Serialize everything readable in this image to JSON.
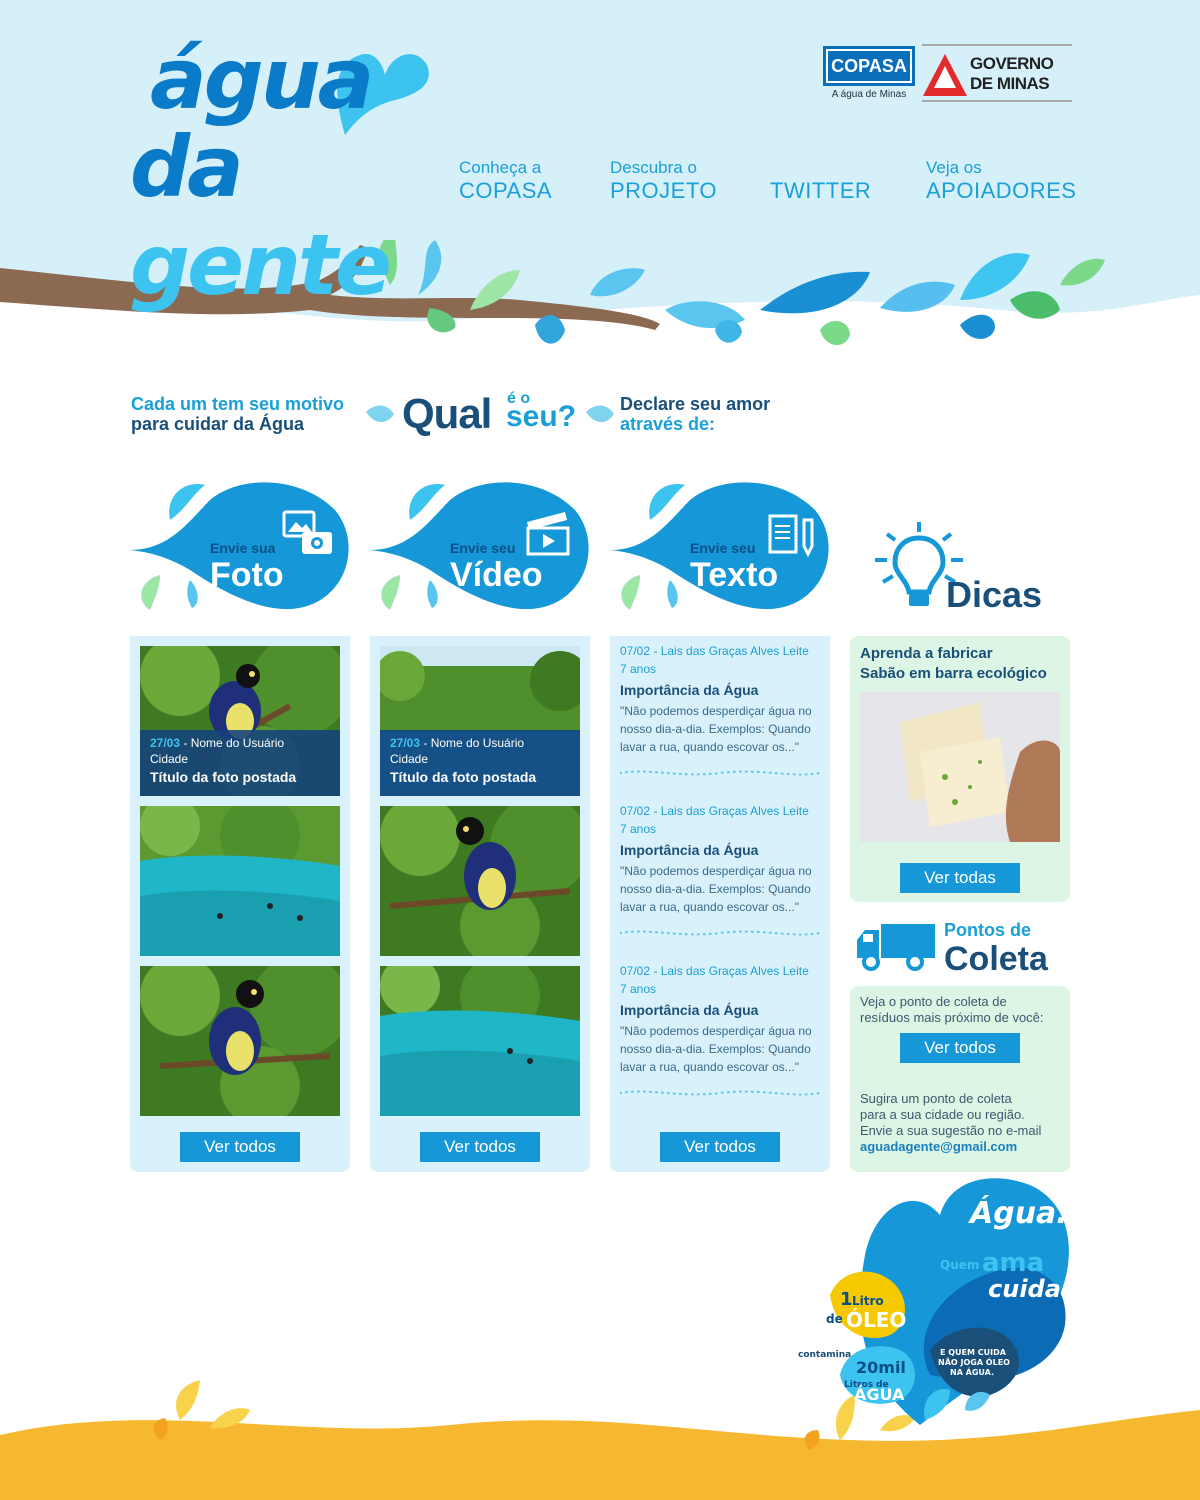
{
  "brand": {
    "logo_line1": "água",
    "logo_line2a": "da ",
    "logo_line2b": "gente"
  },
  "partners": {
    "copasa": "COPASA",
    "copasa_tagline": "A água de Minas",
    "gov_line1": "GOVERNO",
    "gov_line2": "DE MINAS"
  },
  "nav": [
    {
      "small": "Conheça a",
      "big": "COPASA"
    },
    {
      "small": "Descubra o",
      "big": "PROJETO"
    },
    {
      "small": "",
      "big": "TWITTER"
    },
    {
      "small": "Veja os",
      "big": "APOIADORES"
    }
  ],
  "tagline": {
    "left1": "Cada um tem seu motivo",
    "left2": "para cuidar da Água",
    "qual": "Qual",
    "eo": "é o",
    "seu": "seu?",
    "right1": "Declare seu amor",
    "right2": "através de:"
  },
  "columns": {
    "foto": {
      "small": "Envie sua",
      "big": "Foto",
      "caption": {
        "date": "27/03",
        "user": " - Nome do Usuário",
        "city": "Cidade",
        "title": "Título da foto postada"
      },
      "button": "Ver todos"
    },
    "video": {
      "small": "Envie seu",
      "big": "Vídeo",
      "caption": {
        "date": "27/03",
        "user": " - Nome do Usuário",
        "city": "Cidade",
        "title": "Título da foto postada"
      },
      "button": "Ver todos"
    },
    "texto": {
      "small": "Envie seu",
      "big": "Texto",
      "posts": [
        {
          "meta1": "07/02 - Lais das Graças Alves Leite",
          "meta2": "7 anos",
          "title": "Importância da Água",
          "excerpt": "\"Não podemos desperdiçar água no nosso dia-a-dia. Exemplos: Quando lavar a rua, quando escovar os...\""
        },
        {
          "meta1": "07/02 - Lais das Graças Alves Leite",
          "meta2": "7 anos",
          "title": "Importância da Água",
          "excerpt": "\"Não podemos desperdiçar água no nosso dia-a-dia. Exemplos: Quando lavar a rua, quando escovar os...\""
        },
        {
          "meta1": "07/02 - Lais das Graças Alves Leite",
          "meta2": "7 anos",
          "title": "Importância da Água",
          "excerpt": "\"Não podemos desperdiçar água no nosso dia-a-dia. Exemplos: Quando lavar a rua, quando escovar os...\""
        }
      ],
      "button": "Ver todos"
    }
  },
  "dicas": {
    "title": "Dicas",
    "line1": "Aprenda a fabricar",
    "line2": "Sabão em barra ecológico",
    "button": "Ver todas"
  },
  "coleta": {
    "small": "Pontos de",
    "big": "Coleta",
    "text1": "Veja o ponto de coleta de",
    "text2": "resíduos mais próximo de você:",
    "button": "Ver todos",
    "s1": "Sugira um ponto de coleta",
    "s2": "para a sua cidade ou região.",
    "s3": "Envie a sua sugestão no e-mail",
    "email": "aguadagente@gmail.com"
  },
  "campaign": {
    "agua": "Água.",
    "quem": "Quem",
    "ama": "ama",
    "cuida": "cuida.",
    "litro_num": "1",
    "litro": "Litro",
    "de": "de",
    "oleo": "ÓLEO",
    "contamina": "contamina",
    "vinte": "20mil",
    "litros": "Litros",
    "de2": "de",
    "agua2": "ÁGUA",
    "quote1": "E QUEM CUIDA",
    "quote2": "NÃO JOGA ÓLEO",
    "quote3": "NA ÁGUA."
  },
  "colors": {
    "sky": "#d6f0fa",
    "accent": "#1698d8",
    "navy": "#1a4f7a",
    "green_box": "#dcf5e4",
    "blue_box": "#d9f1fb",
    "sand": "#f5b830"
  }
}
